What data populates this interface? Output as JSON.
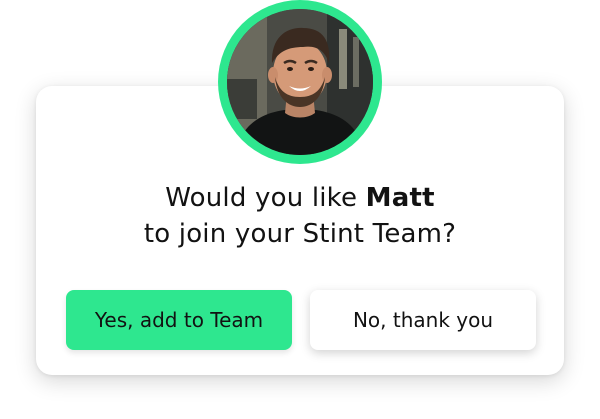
{
  "prompt": {
    "line1_prefix": "Would you like ",
    "name": "Matt",
    "line2": "to join your Stint Team?"
  },
  "buttons": {
    "yes_label": "Yes, add to Team",
    "no_label": "No, thank you"
  },
  "colors": {
    "accent": "#2ee78f",
    "text": "#121212",
    "card": "#ffffff"
  },
  "icons": {
    "avatar": "profile-photo"
  }
}
